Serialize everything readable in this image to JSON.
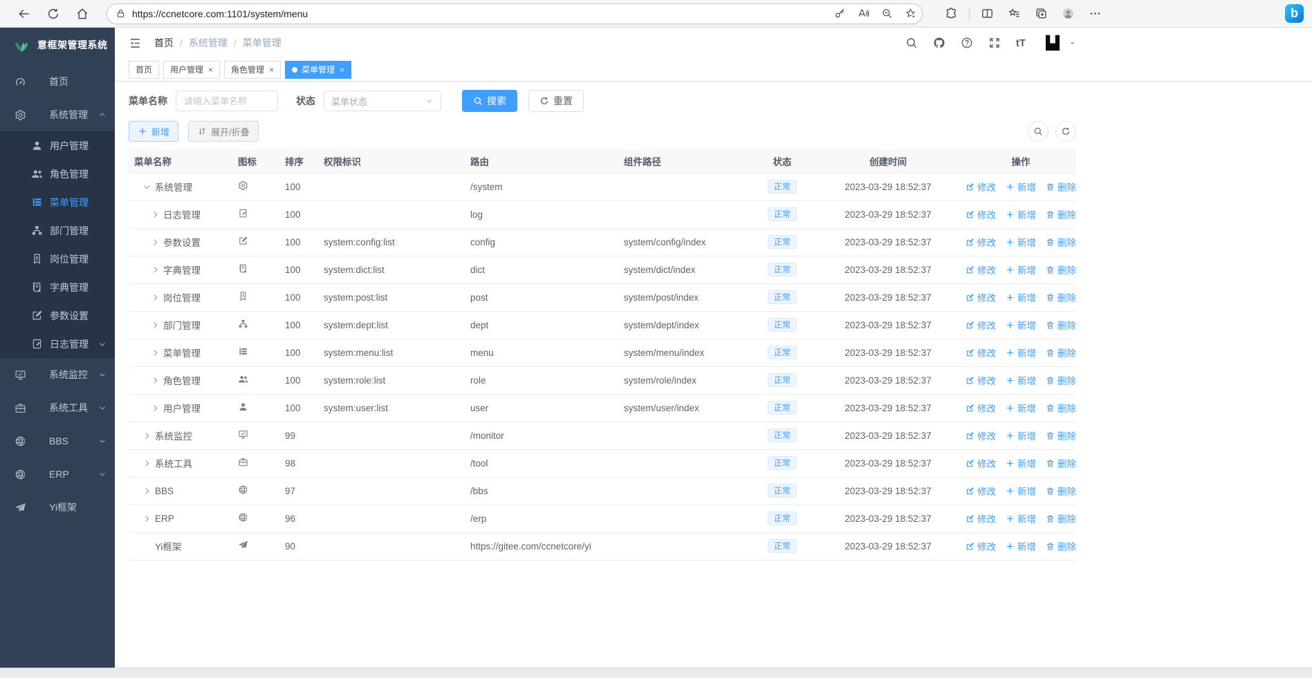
{
  "browser": {
    "url": "https://ccnetcore.com:1101/system/menu"
  },
  "colors": {
    "accent": "#409eff",
    "sidebar_bg": "#304156",
    "sidebar_sub_bg": "#263445",
    "status_normal_bg": "#ecf5ff",
    "status_normal_text": "#409eff"
  },
  "header": {
    "logo_text": "意框架管理系统",
    "breadcrumb": [
      "首页",
      "系统管理",
      "菜单管理"
    ],
    "font_size_label": "tT"
  },
  "sidebar": {
    "items": [
      {
        "key": "home",
        "icon": "dashboard",
        "label": "首页",
        "level": 0
      },
      {
        "key": "system",
        "icon": "gear",
        "label": "系统管理",
        "level": 0,
        "arrow": "up",
        "open": true
      },
      {
        "key": "user",
        "icon": "user",
        "label": "用户管理",
        "level": 1
      },
      {
        "key": "role",
        "icon": "peoples",
        "label": "角色管理",
        "level": 1
      },
      {
        "key": "menu",
        "icon": "tree-table",
        "label": "菜单管理",
        "level": 1,
        "active": true
      },
      {
        "key": "dept",
        "icon": "tree",
        "label": "部门管理",
        "level": 1
      },
      {
        "key": "post",
        "icon": "post",
        "label": "岗位管理",
        "level": 1
      },
      {
        "key": "dict",
        "icon": "dict",
        "label": "字典管理",
        "level": 1
      },
      {
        "key": "config",
        "icon": "edit",
        "label": "参数设置",
        "level": 1
      },
      {
        "key": "log",
        "icon": "log",
        "label": "日志管理",
        "level": 1,
        "arrow": "down"
      },
      {
        "key": "monitor",
        "icon": "monitor",
        "label": "系统监控",
        "level": 0,
        "arrow": "down"
      },
      {
        "key": "tool",
        "icon": "tool",
        "label": "系统工具",
        "level": 0,
        "arrow": "down"
      },
      {
        "key": "bbs",
        "icon": "globe",
        "label": "BBS",
        "level": 0,
        "arrow": "down"
      },
      {
        "key": "erp",
        "icon": "globe",
        "label": "ERP",
        "level": 0,
        "arrow": "down"
      },
      {
        "key": "yi",
        "icon": "send",
        "label": "Yi框架",
        "level": 0
      }
    ]
  },
  "tabs": [
    {
      "key": "home",
      "label": "首页"
    },
    {
      "key": "user",
      "label": "用户管理",
      "closable": true
    },
    {
      "key": "role",
      "label": "角色管理",
      "closable": true
    },
    {
      "key": "menu",
      "label": "菜单管理",
      "closable": true,
      "active": true
    }
  ],
  "filters": {
    "name_label": "菜单名称",
    "name_placeholder": "请输入菜单名称",
    "status_label": "状态",
    "status_placeholder": "菜单状态",
    "search": "搜索",
    "reset": "重置"
  },
  "toolbar": {
    "add": "新增",
    "toggle": "展开/折叠"
  },
  "table": {
    "columns": [
      "菜单名称",
      "图标",
      "排序",
      "权限标识",
      "路由",
      "组件路径",
      "状态",
      "创建时间",
      "操作"
    ],
    "action_labels": {
      "edit": "修改",
      "add": "新增",
      "del": "删除"
    },
    "rows": [
      {
        "name": "系统管理",
        "icon": "gear",
        "sort": "100",
        "perm": "",
        "route": "/system",
        "component": "",
        "status": "正常",
        "created": "2023-03-29 18:52:37",
        "level": 0,
        "expand": "open"
      },
      {
        "name": "日志管理",
        "icon": "log",
        "sort": "100",
        "perm": "",
        "route": "log",
        "component": "",
        "status": "正常",
        "created": "2023-03-29 18:52:37",
        "level": 1,
        "expand": "closed"
      },
      {
        "name": "参数设置",
        "icon": "edit",
        "sort": "100",
        "perm": "system:config:list",
        "route": "config",
        "component": "system/config/index",
        "status": "正常",
        "created": "2023-03-29 18:52:37",
        "level": 1,
        "expand": "closed"
      },
      {
        "name": "字典管理",
        "icon": "dict",
        "sort": "100",
        "perm": "system:dict:list",
        "route": "dict",
        "component": "system/dict/index",
        "status": "正常",
        "created": "2023-03-29 18:52:37",
        "level": 1,
        "expand": "closed"
      },
      {
        "name": "岗位管理",
        "icon": "post",
        "sort": "100",
        "perm": "system:post:list",
        "route": "post",
        "component": "system/post/index",
        "status": "正常",
        "created": "2023-03-29 18:52:37",
        "level": 1,
        "expand": "closed"
      },
      {
        "name": "部门管理",
        "icon": "tree",
        "sort": "100",
        "perm": "system:dept:list",
        "route": "dept",
        "component": "system/dept/index",
        "status": "正常",
        "created": "2023-03-29 18:52:37",
        "level": 1,
        "expand": "closed"
      },
      {
        "name": "菜单管理",
        "icon": "tree-table",
        "sort": "100",
        "perm": "system:menu:list",
        "route": "menu",
        "component": "system/menu/index",
        "status": "正常",
        "created": "2023-03-29 18:52:37",
        "level": 1,
        "expand": "closed"
      },
      {
        "name": "角色管理",
        "icon": "peoples",
        "sort": "100",
        "perm": "system:role:list",
        "route": "role",
        "component": "system/role/index",
        "status": "正常",
        "created": "2023-03-29 18:52:37",
        "level": 1,
        "expand": "closed"
      },
      {
        "name": "用户管理",
        "icon": "user",
        "sort": "100",
        "perm": "system:user:list",
        "route": "user",
        "component": "system/user/index",
        "status": "正常",
        "created": "2023-03-29 18:52:37",
        "level": 1,
        "expand": "closed"
      },
      {
        "name": "系统监控",
        "icon": "monitor",
        "sort": "99",
        "perm": "",
        "route": "/monitor",
        "component": "",
        "status": "正常",
        "created": "2023-03-29 18:52:37",
        "level": 0,
        "expand": "closed"
      },
      {
        "name": "系统工具",
        "icon": "tool",
        "sort": "98",
        "perm": "",
        "route": "/tool",
        "component": "",
        "status": "正常",
        "created": "2023-03-29 18:52:37",
        "level": 0,
        "expand": "closed"
      },
      {
        "name": "BBS",
        "icon": "globe",
        "sort": "97",
        "perm": "",
        "route": "/bbs",
        "component": "",
        "status": "正常",
        "created": "2023-03-29 18:52:37",
        "level": 0,
        "expand": "closed"
      },
      {
        "name": "ERP",
        "icon": "globe",
        "sort": "96",
        "perm": "",
        "route": "/erp",
        "component": "",
        "status": "正常",
        "created": "2023-03-29 18:52:37",
        "level": 0,
        "expand": "closed"
      },
      {
        "name": "Yi框架",
        "icon": "send",
        "sort": "90",
        "perm": "",
        "route": "https://gitee.com/ccnetcore/yi",
        "component": "",
        "status": "正常",
        "created": "2023-03-29 18:52:37",
        "level": 0,
        "expand": "none"
      }
    ]
  }
}
